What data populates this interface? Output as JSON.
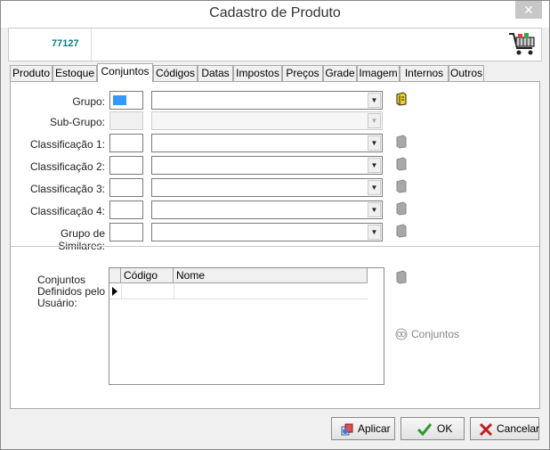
{
  "window": {
    "title": "Cadastro de Produto",
    "close_glyph": "✕"
  },
  "header": {
    "product_code": "77127",
    "icon": "shopping-cart-icon"
  },
  "tabs": [
    {
      "label": "Produto"
    },
    {
      "label": "Estoque"
    },
    {
      "label": "Conjuntos",
      "active": true
    },
    {
      "label": "Códigos"
    },
    {
      "label": "Datas"
    },
    {
      "label": "Impostos"
    },
    {
      "label": "Preços"
    },
    {
      "label": "Grade"
    },
    {
      "label": "Imagem"
    },
    {
      "label": "Internos"
    },
    {
      "label": "Outros"
    }
  ],
  "form": {
    "rows": [
      {
        "label": "Grupo:"
      },
      {
        "label": "Sub-Grupo:"
      },
      {
        "label": "Classificação 1:"
      },
      {
        "label": "Classificação 2:"
      },
      {
        "label": "Classificação 3:"
      },
      {
        "label": "Classificação 4:"
      },
      {
        "label": "Grupo de Similares:"
      }
    ]
  },
  "conjuntos": {
    "label": "Conjuntos Definidos pelo Usuário:",
    "grid_headers": [
      "Código",
      "Nome"
    ],
    "button_label": "Conjuntos"
  },
  "buttons": {
    "apply": "Aplicar",
    "ok": "OK",
    "cancel": "Cancelar"
  },
  "colors": {
    "accent": "#3399ff",
    "code_text": "#0a8080"
  }
}
